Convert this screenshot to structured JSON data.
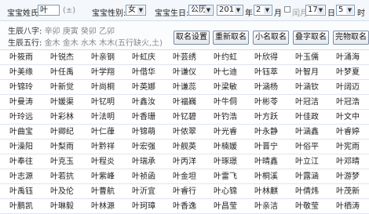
{
  "form": {
    "surname_label": "宝宝姓氏:",
    "surname_value": "叶",
    "surname_hint": "(±)",
    "gender_label": "宝宝性别:",
    "gender_value": "女",
    "birthday_label": "宝宝生日:",
    "calendar_value": "公历",
    "year_value": "2011",
    "year_unit": "年",
    "month_value": "2",
    "month_unit": "月",
    "leap_label": "闰月",
    "day_value": "17",
    "day_unit": "日",
    "hour_value": "5",
    "hour_unit": "时"
  },
  "info": {
    "bazi_label": "生辰八字:",
    "bazi_value": "辛卯 庚寅 癸卯 乙卯",
    "wuxing_label": "生辰五行:",
    "wuxing_value": "金木 金木 水木 木木(五行缺火,土)"
  },
  "buttons": {
    "settings": "取名设置",
    "rename": "重新取名",
    "nickname": "小名取名",
    "double": "叠字取名",
    "perfect": "完物取名"
  },
  "names": [
    [
      "叶筱雨",
      "叶锐杰",
      "叶亲钢",
      "叶虹庆",
      "叶芸绣",
      "叶约虹",
      "叶欣得",
      "叶玉儒",
      "叶涌海"
    ],
    [
      "叶美缘",
      "叶任禹",
      "叶学翔",
      "叶借华",
      "叶谦仪",
      "叶七迪",
      "叶钰萃",
      "叶智月",
      "叶梦夏"
    ],
    [
      "叶锦玲",
      "叶新觉",
      "叶尚桐",
      "叶英娜",
      "叶谦蕊",
      "叶梁敏",
      "叶涵杨",
      "叶涵钦",
      "叶阔迈"
    ],
    [
      "叶曼涛",
      "叶媛渠",
      "叶钇明",
      "叶鑫汝",
      "叶福巍",
      "叶牛侗",
      "叶彬苓",
      "叶冠洁",
      "叶冠浩"
    ],
    [
      "叶玲远",
      "叶彩林",
      "叶法明",
      "叶香珊",
      "叶钇碧",
      "叶钓浩",
      "叶方跃",
      "叶佳政",
      "叶文中"
    ],
    [
      "叶曲宝",
      "叶卿纪",
      "叶仁葎",
      "叶锦萌",
      "叶侬翠",
      "叶光睿",
      "叶永静",
      "叶涵鑫",
      "叶睿婷"
    ],
    [
      "叶澡阳",
      "叶梨雨",
      "叶黔祥",
      "叶宏强",
      "叶舰英",
      "叶楠媛",
      "叶晋宁",
      "叶俗平",
      "叶宪雨"
    ],
    [
      "叶奉往",
      "叶克玉",
      "叶程炎",
      "叶瑞承",
      "叶丙洋",
      "叶琢璟",
      "叶晴鑫",
      "叶立江",
      "叶邓晴"
    ],
    [
      "叶志源",
      "叶若抗",
      "叶紫峰",
      "叶祯函",
      "叶金坦",
      "叶雷飞",
      "叶桐溪",
      "叶露涵",
      "叶游梦"
    ],
    [
      "叶禹钰",
      "叶及伦",
      "叶曹航",
      "叶沂宜",
      "叶睿行",
      "叶心锦",
      "叶林麒",
      "叶倩炜",
      "叶茂新"
    ],
    [
      "叶鹏凯",
      "叶琳毅",
      "叶林源",
      "叶珂璋",
      "叶香逸",
      "叶昌莹",
      "叶亲洁",
      "叶敬莹",
      "叶栖涛"
    ]
  ]
}
